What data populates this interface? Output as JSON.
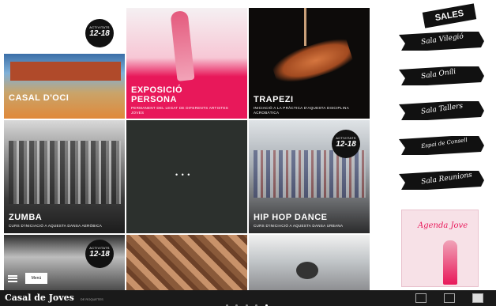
{
  "tiles": {
    "casal": {
      "title": "CASAL D'OCI"
    },
    "exposicio": {
      "title_l1": "EXPOSICIÓ",
      "title_l2": "PERSONA",
      "sub": "PERMANENT DEL LEGAT DE DIFERENTS ARTISTES JOVES"
    },
    "trapezi": {
      "title": "TRAPEZI",
      "sub": "INICIACIÓ A LA PRÀCTICA D'AQUESTA DISCIPLINA ACROBÀTICA"
    },
    "zumba": {
      "title": "ZUMBA",
      "sub": "CURS D'INICIACIÓ A AQUESTA DANSA AERÒBICA"
    },
    "center": {
      "dots": "• • •"
    },
    "hiphop": {
      "title": "HIP HOP DANCE",
      "sub": "CURS D'INICIACIÓ A AQUESTA DANSA URBANA"
    }
  },
  "badge": {
    "line1": "ACTIVITATS",
    "line2": "12-18"
  },
  "sidebar": {
    "sales_title": "SALES",
    "rooms": [
      "Sala Vilegió",
      "Sala Oníli",
      "Sala Tallers",
      "Espai de Consell",
      "Sala Reunions"
    ],
    "agenda_title": "Agenda Jove"
  },
  "menu": {
    "label": "Menú"
  },
  "footer": {
    "logo": "Casal de Joves",
    "logo_sub": "DE ROQUETES"
  },
  "colors": {
    "accent_pink": "#e8185a",
    "dark": "#111111"
  }
}
